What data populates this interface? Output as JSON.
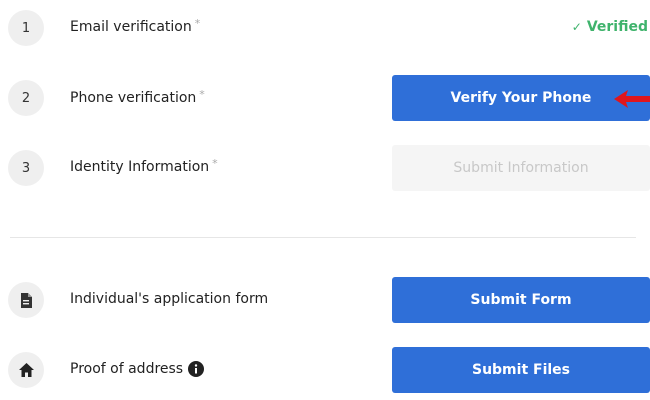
{
  "steps": [
    {
      "number": "1",
      "label": "Email verification",
      "required_mark": "*",
      "status": "Verified"
    },
    {
      "number": "2",
      "label": "Phone verification",
      "required_mark": "*",
      "button": "Verify Your Phone"
    },
    {
      "number": "3",
      "label": "Identity Information",
      "required_mark": "*",
      "button": "Submit Information"
    }
  ],
  "documents": [
    {
      "icon": "document-icon",
      "label": "Individual's application form",
      "button": "Submit Form"
    },
    {
      "icon": "home-icon",
      "label": "Proof of address",
      "info_icon": "info-icon",
      "button": "Submit Files"
    }
  ],
  "colors": {
    "primary_button": "#2f6fd8",
    "verified_text": "#3fb36c",
    "disabled_button_bg": "#f5f5f5",
    "disabled_button_text": "#c8c8c8",
    "annotation_arrow": "#e0161c"
  }
}
